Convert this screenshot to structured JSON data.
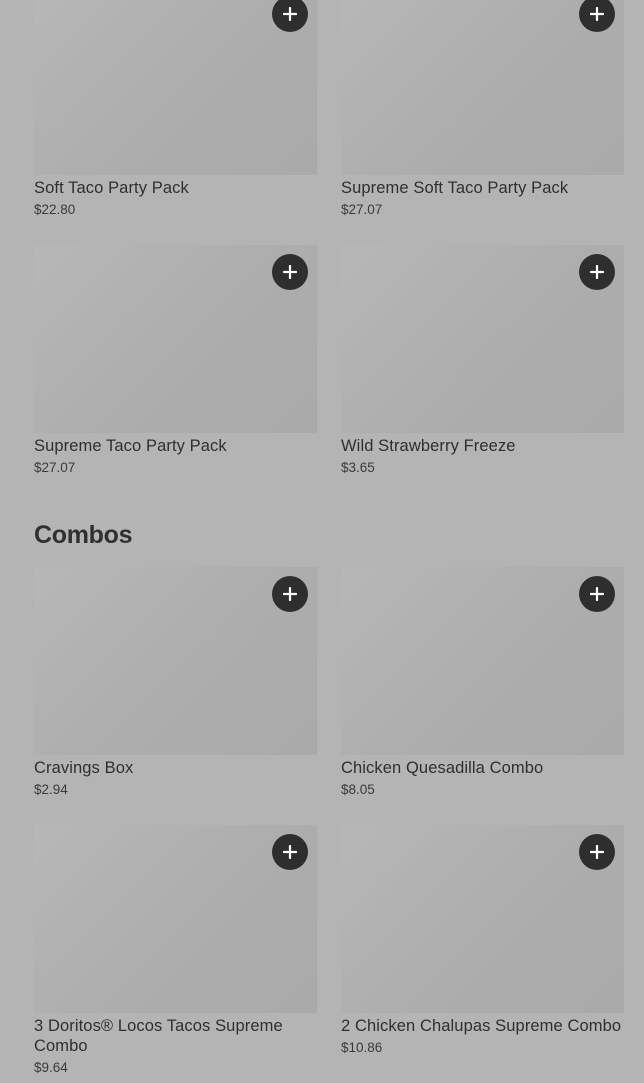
{
  "party_packs": [
    {
      "name": "Soft Taco Party Pack",
      "price": "$22.80"
    },
    {
      "name": "Supreme Soft Taco Party Pack",
      "price": "$27.07"
    },
    {
      "name": "Supreme Taco Party Pack",
      "price": "$27.07"
    },
    {
      "name": "Wild Strawberry Freeze",
      "price": "$3.65"
    }
  ],
  "combos": {
    "title": "Combos",
    "items": [
      {
        "name": "Cravings Box",
        "price": "$2.94"
      },
      {
        "name": "Chicken Quesadilla Combo",
        "price": "$8.05"
      },
      {
        "name": "3 Doritos® Locos Tacos Supreme Combo",
        "price": "$9.64"
      },
      {
        "name": "2 Chicken Chalupas Supreme Combo",
        "price": "$10.86"
      }
    ]
  },
  "icons": {
    "add": "plus-icon"
  },
  "colors": {
    "background": "#b4b4b4",
    "add_button": "#2e2e2e",
    "text": "#2f2f2f"
  }
}
